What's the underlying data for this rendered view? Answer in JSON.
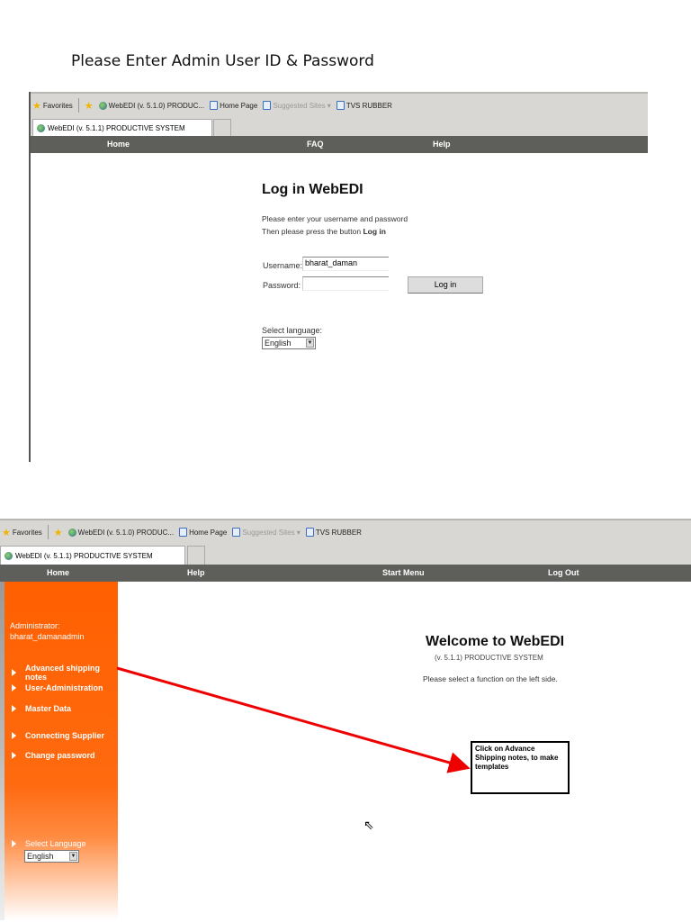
{
  "heading": "Please Enter Admin User ID & Password",
  "browser": {
    "favorites": "Favorites",
    "fav_links": [
      "WebEDI (v. 5.1.0) PRODUC...",
      "Home Page",
      "Suggested Sites ▾",
      "TVS RUBBER"
    ],
    "tab_title": "WebEDI (v. 5.1.1) PRODUCTIVE SYSTEM"
  },
  "login": {
    "nav": [
      "Home",
      "FAQ",
      "Help"
    ],
    "title": "Log in WebEDI",
    "instr1": "Please enter your username and password",
    "instr2_prefix": "Then please press the button",
    "instr2_button": "Log in",
    "username_label": "Username:",
    "username_value": "bharat_daman",
    "password_label": "Password:",
    "password_value": "",
    "login_button": "Log in",
    "lang_label": "Select language:",
    "lang_value": "English"
  },
  "admin": {
    "nav": [
      "Home",
      "Help",
      "Start Menu",
      "Log Out"
    ],
    "user_label": "Administrator:",
    "user_name": "bharat_damanadmin",
    "menu": [
      "Advanced shipping notes",
      "User-Administration",
      "Master Data",
      "Connecting Supplier",
      "Change password"
    ],
    "lang_label": "Select Language",
    "lang_value": "English",
    "welcome": "Welcome to WebEDI",
    "version": "(v. 5.1.1) PRODUCTIVE SYSTEM",
    "instruction": "Please select a function on the left side.",
    "callout": "Click on Advance Shipping notes, to make templates"
  }
}
